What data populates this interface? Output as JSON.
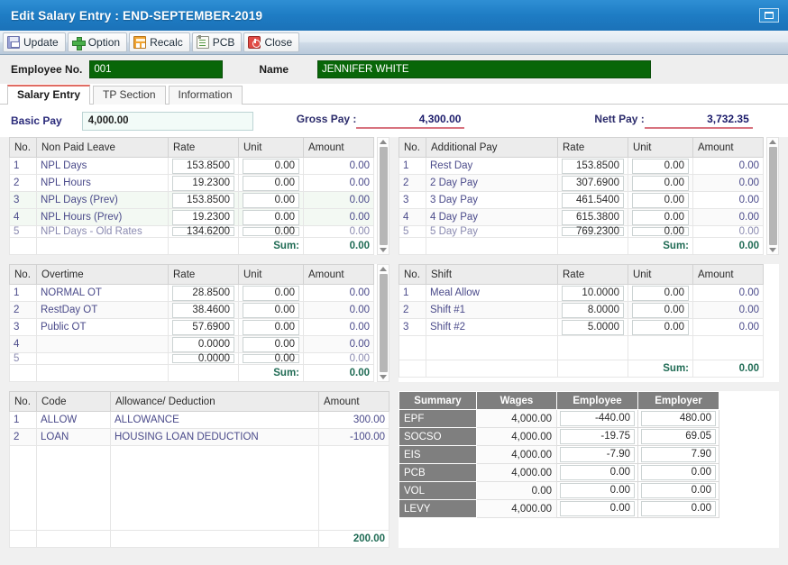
{
  "window": {
    "title": "Edit Salary Entry : END-SEPTEMBER-2019",
    "restore_button": "restore-window"
  },
  "toolbar": {
    "buttons": [
      {
        "label": "Update",
        "icon": "save-icon"
      },
      {
        "label": "Option",
        "icon": "plus-icon"
      },
      {
        "label": "Recalc",
        "icon": "calculator-icon"
      },
      {
        "label": "PCB",
        "icon": "notepad-icon"
      },
      {
        "label": "Close",
        "icon": "power-icon"
      }
    ]
  },
  "employee": {
    "no_label": "Employee No.",
    "no_value": "001",
    "name_label": "Name",
    "name_value": "JENNIFER WHITE"
  },
  "tabs": [
    {
      "label": "Salary Entry",
      "active": true
    },
    {
      "label": "TP Section",
      "active": false
    },
    {
      "label": "Information",
      "active": false
    }
  ],
  "pay": {
    "basic_label": "Basic Pay",
    "basic_value": "4,000.00",
    "gross_label": "Gross Pay :",
    "gross_value": "4,300.00",
    "nett_label": "Nett Pay :",
    "nett_value": "3,732.35"
  },
  "grids": {
    "npl": {
      "headers": [
        "No.",
        "Non Paid Leave",
        "Rate",
        "Unit",
        "Amount"
      ],
      "rows": [
        {
          "no": "1",
          "name": "NPL Days",
          "rate": "153.8500",
          "unit": "0.00",
          "amount": "0.00",
          "tint": false
        },
        {
          "no": "2",
          "name": "NPL Hours",
          "rate": "19.2300",
          "unit": "0.00",
          "amount": "0.00",
          "tint": false
        },
        {
          "no": "3",
          "name": "NPL Days (Prev)",
          "rate": "153.8500",
          "unit": "0.00",
          "amount": "0.00",
          "tint": true
        },
        {
          "no": "4",
          "name": "NPL Hours (Prev)",
          "rate": "19.2300",
          "unit": "0.00",
          "amount": "0.00",
          "tint": true
        },
        {
          "no": "5",
          "name": "NPL Days - Old Rates",
          "rate": "134.6200",
          "unit": "0.00",
          "amount": "0.00",
          "tint": false,
          "clipped": true
        }
      ],
      "sum_label": "Sum:",
      "sum_value": "0.00"
    },
    "additional": {
      "headers": [
        "No.",
        "Additional Pay",
        "Rate",
        "Unit",
        "Amount"
      ],
      "rows": [
        {
          "no": "1",
          "name": "Rest Day",
          "rate": "153.8500",
          "unit": "0.00",
          "amount": "0.00",
          "tint": false
        },
        {
          "no": "2",
          "name": "2 Day Pay",
          "rate": "307.6900",
          "unit": "0.00",
          "amount": "0.00",
          "tint": false
        },
        {
          "no": "3",
          "name": "3 Day Pay",
          "rate": "461.5400",
          "unit": "0.00",
          "amount": "0.00",
          "tint": false
        },
        {
          "no": "4",
          "name": "4 Day Pay",
          "rate": "615.3800",
          "unit": "0.00",
          "amount": "0.00",
          "tint": false
        },
        {
          "no": "5",
          "name": "5 Day Pay",
          "rate": "769.2300",
          "unit": "0.00",
          "amount": "0.00",
          "tint": false,
          "clipped": true
        }
      ],
      "sum_label": "Sum:",
      "sum_value": "0.00"
    },
    "overtime": {
      "headers": [
        "No.",
        "Overtime",
        "Rate",
        "Unit",
        "Amount"
      ],
      "rows": [
        {
          "no": "1",
          "name": "NORMAL OT",
          "rate": "28.8500",
          "unit": "0.00",
          "amount": "0.00",
          "tint": false
        },
        {
          "no": "2",
          "name": "RestDay OT",
          "rate": "38.4600",
          "unit": "0.00",
          "amount": "0.00",
          "tint": false
        },
        {
          "no": "3",
          "name": "Public OT",
          "rate": "57.6900",
          "unit": "0.00",
          "amount": "0.00",
          "tint": false
        },
        {
          "no": "4",
          "name": "",
          "rate": "0.0000",
          "unit": "0.00",
          "amount": "0.00",
          "tint": false
        },
        {
          "no": "5",
          "name": "",
          "rate": "0.0000",
          "unit": "0.00",
          "amount": "0.00",
          "tint": false,
          "clipped": true
        }
      ],
      "sum_label": "Sum:",
      "sum_value": "0.00"
    },
    "shift": {
      "headers": [
        "No.",
        "Shift",
        "Rate",
        "Unit",
        "Amount"
      ],
      "rows": [
        {
          "no": "1",
          "name": "Meal Allow",
          "rate": "10.0000",
          "unit": "0.00",
          "amount": "0.00",
          "tint": false
        },
        {
          "no": "2",
          "name": "Shift #1",
          "rate": "8.0000",
          "unit": "0.00",
          "amount": "0.00",
          "tint": false
        },
        {
          "no": "3",
          "name": "Shift #2",
          "rate": "5.0000",
          "unit": "0.00",
          "amount": "0.00",
          "tint": false
        }
      ],
      "sum_label": "Sum:",
      "sum_value": "0.00"
    },
    "allowance": {
      "headers": [
        "No.",
        "Code",
        "Allowance/ Deduction",
        "Amount"
      ],
      "rows": [
        {
          "no": "1",
          "code": "ALLOW",
          "desc": "ALLOWANCE",
          "amount": "300.00"
        },
        {
          "no": "2",
          "code": "LOAN",
          "desc": "HOUSING LOAN DEDUCTION",
          "amount": "-100.00"
        }
      ],
      "total_value": "200.00"
    }
  },
  "summary": {
    "headers": [
      "Summary",
      "Wages",
      "Employee",
      "Employer"
    ],
    "rows": [
      {
        "label": "EPF",
        "wages": "4,000.00",
        "employee": "-440.00",
        "employer": "480.00"
      },
      {
        "label": "SOCSO",
        "wages": "4,000.00",
        "employee": "-19.75",
        "employer": "69.05"
      },
      {
        "label": "EIS",
        "wages": "4,000.00",
        "employee": "-7.90",
        "employer": "7.90"
      },
      {
        "label": "PCB",
        "wages": "4,000.00",
        "employee": "0.00",
        "employer": "0.00"
      },
      {
        "label": "VOL",
        "wages": "0.00",
        "employee": "0.00",
        "employer": "0.00"
      },
      {
        "label": "LEVY",
        "wages": "4,000.00",
        "employee": "0.00",
        "employer": "0.00"
      }
    ]
  },
  "colors": {
    "titlebar": "#1e7cc4",
    "green_input": "#086608",
    "accent_underline": "#d8737f",
    "summary_header": "#7f7f7f",
    "tab_active_border": "#e06b62",
    "sum_text": "#1f6b54"
  }
}
